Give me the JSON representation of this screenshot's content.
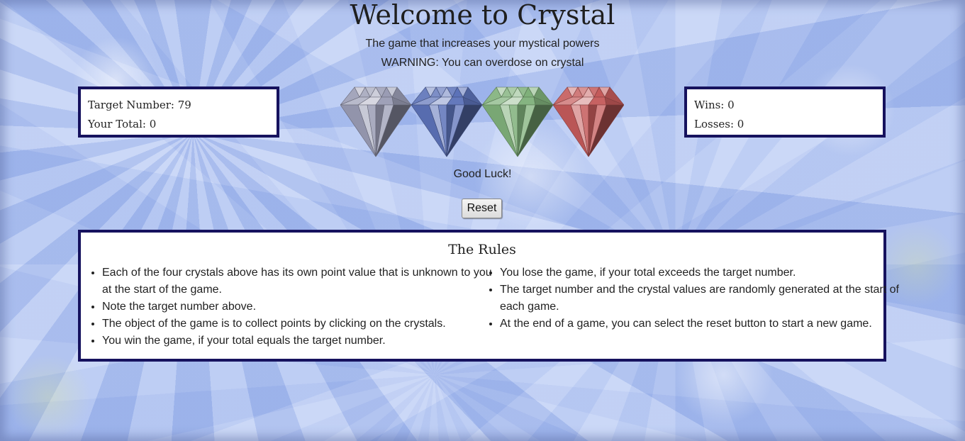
{
  "header": {
    "title": "Welcome to Crystal",
    "subtitle": "The game that increases your mystical powers",
    "warning": "WARNING: You can overdose on crystal"
  },
  "score_panel": {
    "target_label": "Target Number:",
    "target_value": "79",
    "total_label": "Your Total:",
    "total_value": "0"
  },
  "record_panel": {
    "wins_label": "Wins:",
    "wins_value": "0",
    "losses_label": "Losses:",
    "losses_value": "0"
  },
  "crystals": [
    {
      "name": "silver",
      "color": "#9a9cb4"
    },
    {
      "name": "blue",
      "color": "#5c72b8"
    },
    {
      "name": "green",
      "color": "#7fb07a"
    },
    {
      "name": "red",
      "color": "#c45a5a"
    }
  ],
  "status": "Good Luck!",
  "reset_label": "Reset",
  "rules": {
    "title": "The Rules",
    "left": [
      "Each of the four crystals above has its own point value that is unknown to you at the start of the game.",
      "Note the target number above.",
      "The object of the game is to collect points by clicking on the crystals.",
      "You win the game, if your total equals the target number."
    ],
    "right": [
      "You lose the game, if your total exceeds the target number.",
      "The target number and the crystal values are randomly generated at the start of each game.",
      "At the end of a game, you can select the reset button to start a new game."
    ]
  },
  "colors": {
    "border": "#16125e",
    "background": "#b7c8f0"
  }
}
